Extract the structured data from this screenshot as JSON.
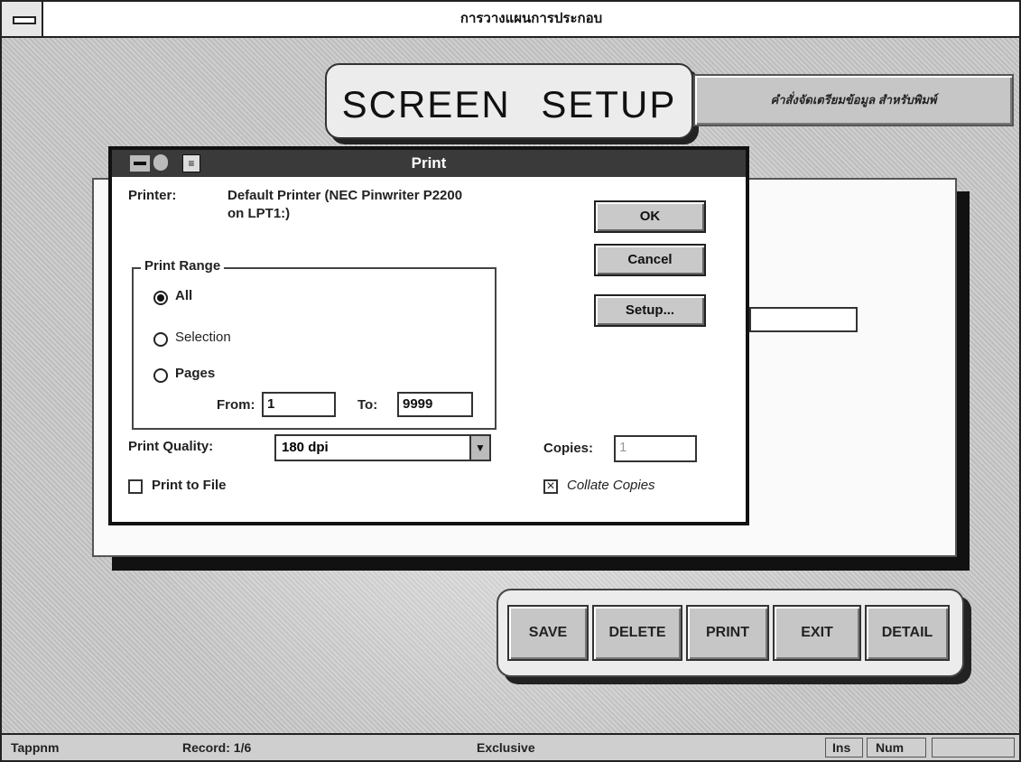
{
  "window": {
    "title": "การวางแผนการประกอบ"
  },
  "banner": {
    "title": "SCREEN SETUP",
    "thai_button": "คำสั่งจัดเตรียมข้อมูล สำหรับพิมพ์"
  },
  "print_dialog": {
    "title": "Print",
    "printer_label": "Printer:",
    "printer_value_line1": "Default Printer (NEC Pinwriter P2200",
    "printer_value_line2": "on LPT1:)",
    "ok_label": "OK",
    "cancel_label": "Cancel",
    "setup_label": "Setup...",
    "print_range": {
      "title": "Print Range",
      "options": [
        "All",
        "Selection",
        "Pages"
      ],
      "selected": "All",
      "from_label": "From:",
      "from_value": "1",
      "to_label": "To:",
      "to_value": "9999"
    },
    "quality_label": "Print Quality:",
    "quality_value": "180 dpi",
    "copies_label": "Copies:",
    "copies_value": "1",
    "print_to_file_label": "Print to File",
    "print_to_file_checked": false,
    "collate_label": "Collate Copies",
    "collate_checked": true
  },
  "actions": [
    "SAVE",
    "DELETE",
    "PRINT",
    "EXIT",
    "DETAIL"
  ],
  "status_bar": {
    "table": "Tappnm",
    "record": "Record: 1/6",
    "mode": "Exclusive",
    "ins": "Ins",
    "num": "Num"
  }
}
